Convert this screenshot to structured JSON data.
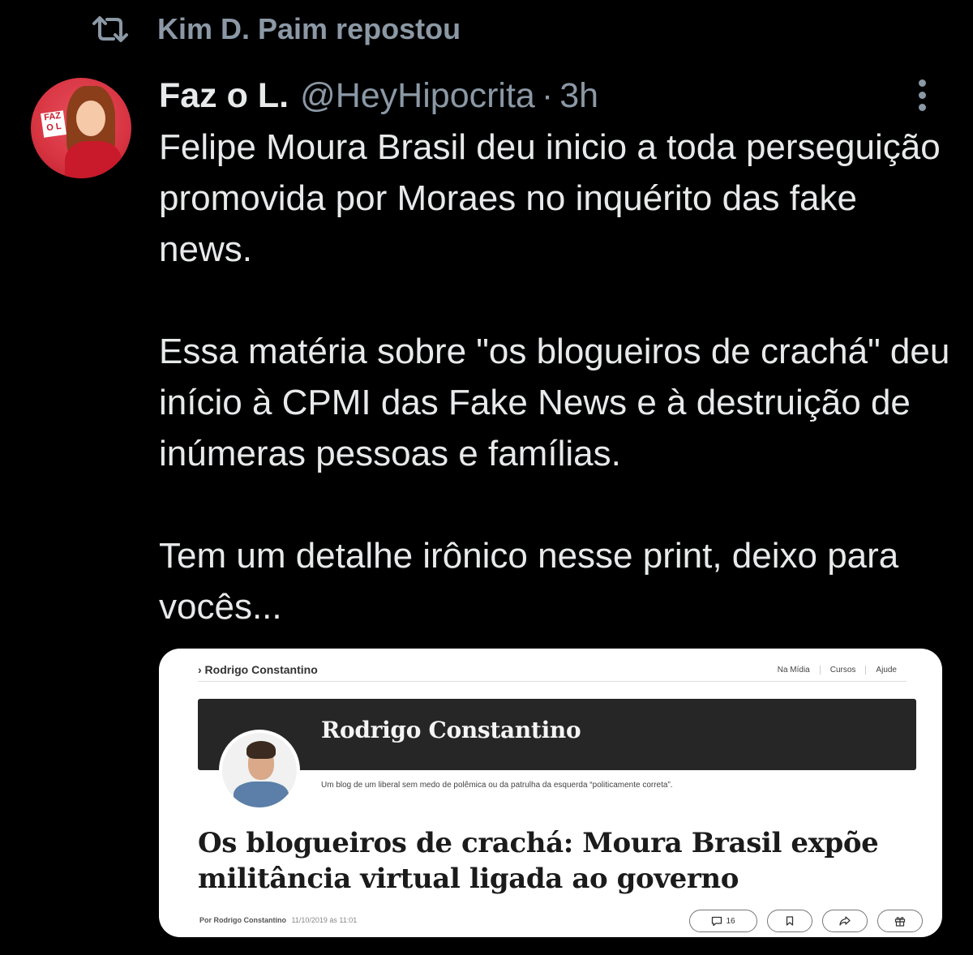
{
  "repost": {
    "icon": "repost-icon",
    "text": "Kim D. Paim repostou"
  },
  "tweet": {
    "avatar_icon": "avatar-image",
    "avatar_sign": "FAZ O L",
    "name": "Faz o L.",
    "handle": "@HeyHipocrita",
    "separator": "·",
    "time": "3h",
    "more_icon": "more-vertical-icon",
    "paragraphs": [
      "Felipe Moura Brasil deu inicio a toda perseguição promovida por Moraes no inquérito das fake news.",
      "Essa matéria sobre \"os blogueiros de crachá\" deu início à CPMI das Fake News e à destruição de inúmeras pessoas e famílias.",
      "Tem um detalhe irônico nesse print, deixo para vocês..."
    ]
  },
  "embedded_image": {
    "breadcrumb": "› Rodrigo Constantino",
    "nav": [
      "Na Mídia",
      "Cursos",
      "Ajude"
    ],
    "blog_title": "Rodrigo Constantino",
    "tagline": "Um blog de um liberal sem medo de polêmica ou da patrulha da esquerda “politicamente correta”.",
    "headline": "Os blogueiros de crachá: Moura Brasil expõe militância virtual ligada ao governo",
    "byline_author": "Por Rodrigo Constantino",
    "byline_date": "11/10/2019 às 11:01",
    "comment_count": "16",
    "action_icons": [
      "comment-icon",
      "bookmark-icon",
      "share-icon",
      "gift-icon"
    ]
  },
  "colors": {
    "background": "#000000",
    "text": "#e7e9ea",
    "muted": "#8b98a5",
    "avatar_red": "#d83442",
    "banner_dark": "#262626"
  }
}
